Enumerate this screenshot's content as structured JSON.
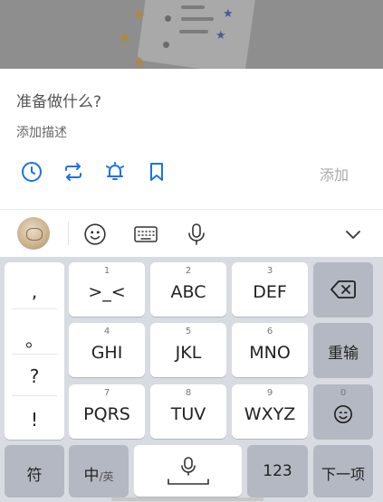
{
  "task_input": {
    "title_placeholder": "准备做什么?",
    "description_placeholder": "添加描述",
    "add_label": "添加",
    "actions": [
      {
        "icon": "clock-icon"
      },
      {
        "icon": "repeat-icon"
      },
      {
        "icon": "alarm-icon"
      },
      {
        "icon": "bookmark-icon"
      }
    ],
    "accent_color": "#1a73e8"
  },
  "keyboard_toolbar": {
    "icons": [
      "avatar",
      "emoji-icon",
      "keyboard-icon",
      "microphone-icon",
      "chevron-down-icon"
    ]
  },
  "keyboard": {
    "punctuation": [
      ",",
      "。",
      "?",
      "!"
    ],
    "rows": [
      [
        {
          "num": "1",
          "label": ">_<"
        },
        {
          "num": "2",
          "label": "ABC"
        },
        {
          "num": "3",
          "label": "DEF"
        }
      ],
      [
        {
          "num": "4",
          "label": "GHI"
        },
        {
          "num": "5",
          "label": "JKL"
        },
        {
          "num": "6",
          "label": "MNO"
        }
      ],
      [
        {
          "num": "7",
          "label": "PQRS"
        },
        {
          "num": "8",
          "label": "TUV"
        },
        {
          "num": "9",
          "label": "WXYZ"
        }
      ]
    ],
    "reenter_label": "重输",
    "zero_num": "0",
    "symbols_label": "符",
    "lang_main": "中",
    "lang_sub": "/英",
    "numbers_label": "123",
    "next_label": "下一项"
  }
}
